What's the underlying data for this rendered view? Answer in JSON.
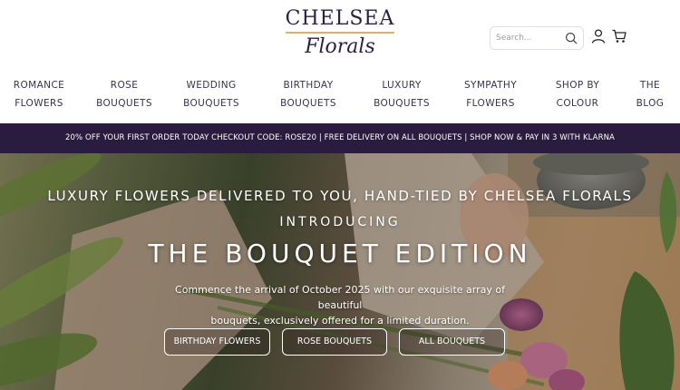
{
  "header": {
    "logo_top": "CHELSEA",
    "logo_bottom": "Florals",
    "search_placeholder": "Search...",
    "icons": [
      "search-icon",
      "user-icon",
      "cart-icon"
    ]
  },
  "nav": {
    "items": [
      {
        "line1": "ROMANCE",
        "line2": "FLOWERS"
      },
      {
        "line1": "ROSE",
        "line2": "BOUQUETS"
      },
      {
        "line1": "WEDDING",
        "line2": "BOUQUETS"
      },
      {
        "line1": "BIRTHDAY",
        "line2": "BOUQUETS"
      },
      {
        "line1": "LUXURY",
        "line2": "BOUQUETS"
      },
      {
        "line1": "SYMPATHY",
        "line2": "FLOWERS"
      },
      {
        "line1": "SHOP BY",
        "line2": "COLOUR"
      },
      {
        "line1": "THE",
        "line2": "BLOG"
      }
    ]
  },
  "promo": {
    "text": "20% OFF YOUR FIRST ORDER TODAY CHECKOUT CODE: ROSE20  |  FREE DELIVERY ON ALL BOUQUETS  |  SHOP NOW & PAY IN 3 WITH KLARNA"
  },
  "hero": {
    "tagline": "LUXURY FLOWERS DELIVERED TO YOU, HAND-TIED BY CHELSEA FLORALS",
    "intro": "INTRODUCING",
    "title": "THE BOUQUET EDITION",
    "desc_line1": "Commence the arrival of October 2025 with our exquisite array of beautiful",
    "desc_line2": "bouquets, exclusively offered for a limited duration.",
    "buttons": [
      "BIRTHDAY FLOWERS",
      "ROSE BOUQUETS",
      "ALL BOUQUETS"
    ]
  },
  "colors": {
    "brand": "#2b1f45",
    "accent": "#d9b36c",
    "promo_bg": "#2a1c3f"
  }
}
